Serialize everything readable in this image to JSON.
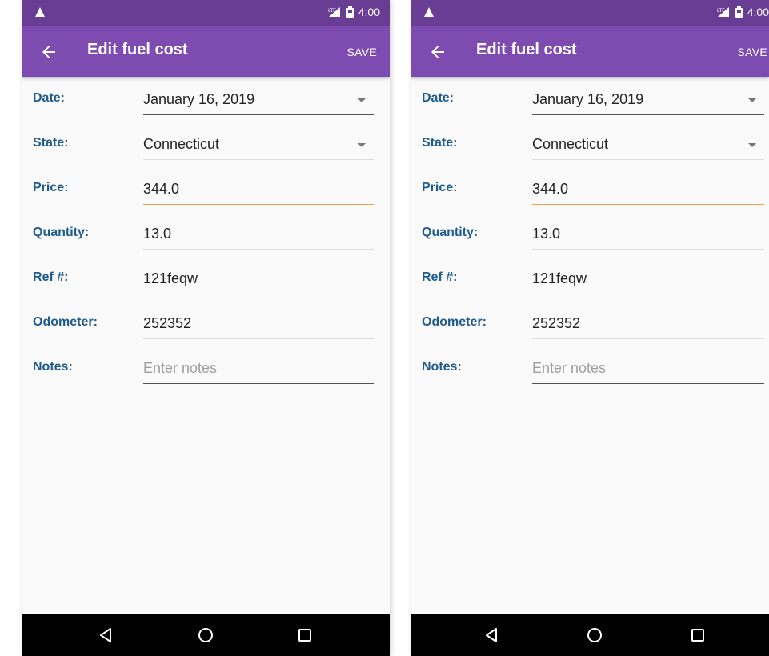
{
  "status": {
    "time": "4:00"
  },
  "app_bar": {
    "title": "Edit fuel cost",
    "save_label": "SAVE"
  },
  "form": {
    "date": {
      "label": "Date:",
      "value": "January 16, 2019"
    },
    "state": {
      "label": "State:",
      "value": "Connecticut"
    },
    "price": {
      "label": "Price:",
      "value": "344.0"
    },
    "quantity": {
      "label": "Quantity:",
      "value": "13.0"
    },
    "ref": {
      "label": "Ref #:",
      "value": "121feqw"
    },
    "odometer": {
      "label": "Odometer:",
      "value": "252352"
    },
    "notes": {
      "label": "Notes:",
      "placeholder": "Enter notes"
    }
  },
  "colors": {
    "status_bar": "#6a3d95",
    "app_bar": "#7e4bb0",
    "label": "#1f5b8c",
    "focus_underline": "#f0a040"
  },
  "icons": [
    "warning-icon",
    "signal-icon",
    "battery-icon",
    "back-arrow-icon",
    "dropdown-icon",
    "nav-back-icon",
    "nav-home-icon",
    "nav-recents-icon"
  ]
}
